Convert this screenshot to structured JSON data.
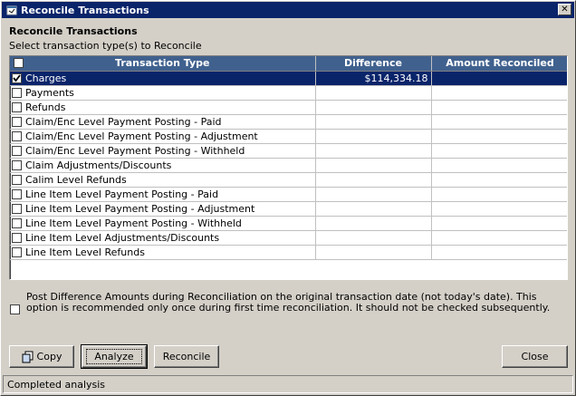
{
  "window": {
    "title": "Reconcile Transactions"
  },
  "heading": "Reconcile Transactions",
  "subheading": "Select transaction type(s) to Reconcile",
  "table": {
    "columns": [
      "Transaction Type",
      "Difference",
      "Amount Reconciled"
    ],
    "rows": [
      {
        "label": "Charges",
        "difference": "$114,334.18",
        "reconciled": "",
        "checked": true,
        "selected": true
      },
      {
        "label": "Payments",
        "difference": "",
        "reconciled": "",
        "checked": false,
        "selected": false
      },
      {
        "label": "Refunds",
        "difference": "",
        "reconciled": "",
        "checked": false,
        "selected": false
      },
      {
        "label": "Claim/Enc Level Payment Posting - Paid",
        "difference": "",
        "reconciled": "",
        "checked": false,
        "selected": false
      },
      {
        "label": "Claim/Enc Level Payment Posting - Adjustment",
        "difference": "",
        "reconciled": "",
        "checked": false,
        "selected": false
      },
      {
        "label": "Claim/Enc Level Payment Posting - Withheld",
        "difference": "",
        "reconciled": "",
        "checked": false,
        "selected": false
      },
      {
        "label": "Claim Adjustments/Discounts",
        "difference": "",
        "reconciled": "",
        "checked": false,
        "selected": false
      },
      {
        "label": "Calim Level Refunds",
        "difference": "",
        "reconciled": "",
        "checked": false,
        "selected": false
      },
      {
        "label": "Line Item Level Payment Posting - Paid",
        "difference": "",
        "reconciled": "",
        "checked": false,
        "selected": false
      },
      {
        "label": "Line Item Level Payment Posting - Adjustment",
        "difference": "",
        "reconciled": "",
        "checked": false,
        "selected": false
      },
      {
        "label": "Line Item Level Payment Posting - Withheld",
        "difference": "",
        "reconciled": "",
        "checked": false,
        "selected": false
      },
      {
        "label": "Line Item Level Adjustments/Discounts",
        "difference": "",
        "reconciled": "",
        "checked": false,
        "selected": false
      },
      {
        "label": "Line Item Level Refunds",
        "difference": "",
        "reconciled": "",
        "checked": false,
        "selected": false
      }
    ]
  },
  "post_option": {
    "text": "Post Difference Amounts during Reconciliation on the original transaction date (not today's date).  This option is recommended only once during first time reconciliation.  It should not be checked subsequently.",
    "checked": false
  },
  "buttons": {
    "copy": "Copy",
    "analyze": "Analyze",
    "reconcile": "Reconcile",
    "close": "Close"
  },
  "status": "Completed analysis",
  "colors": {
    "titlebar": "#0a246a",
    "header": "#40618e",
    "selection": "#0a246a",
    "face": "#d4d0c8"
  },
  "icons": {
    "title": "app-window-icon",
    "close": "close-icon",
    "copy": "copy-icon",
    "check": "checkmark-icon"
  }
}
